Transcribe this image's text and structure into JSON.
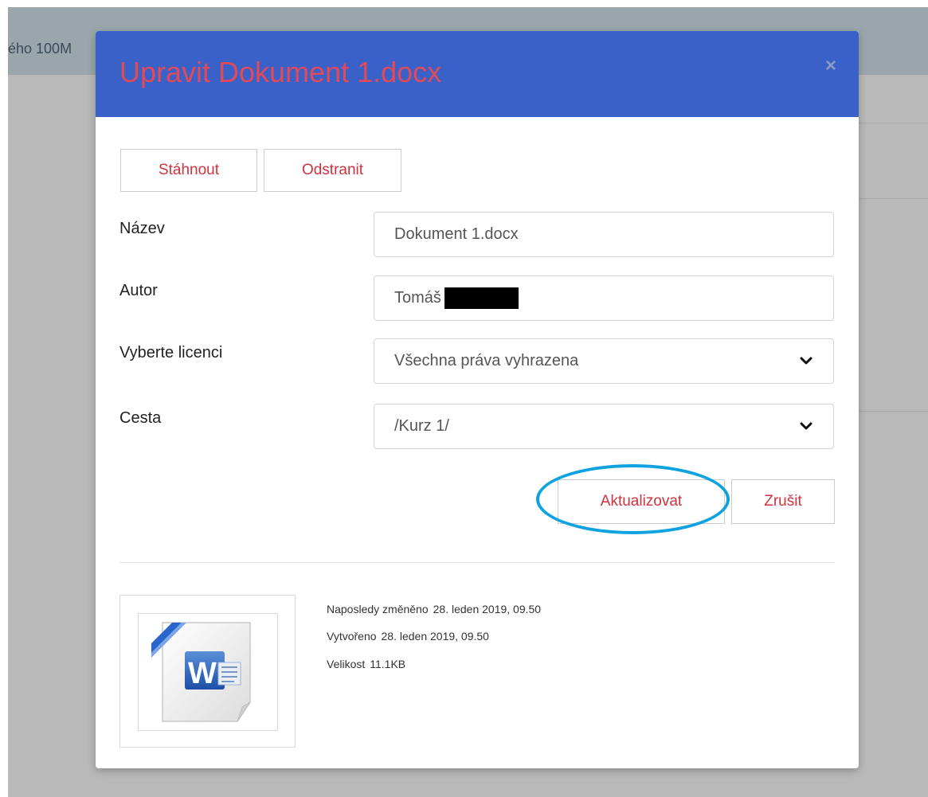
{
  "background": {
    "header_text": "ého 100M"
  },
  "modal": {
    "title": "Upravit Dokument 1.docx",
    "close_icon": "close-icon",
    "close_glyph": "×"
  },
  "toolbar": {
    "download_label": "Stáhnout",
    "delete_label": "Odstranit"
  },
  "form": {
    "name_label": "Název",
    "name_value": "Dokument 1.docx",
    "author_label": "Autor",
    "author_value": "Tomáš",
    "license_label": "Vyberte licenci",
    "license_value": "Všechna práva vyhrazena",
    "path_label": "Cesta",
    "path_value": "/Kurz 1/"
  },
  "actions": {
    "update_label": "Aktualizovat",
    "cancel_label": "Zrušit"
  },
  "file_info": {
    "modified_label": "Naposledy změněno",
    "modified_value": "28. leden 2019, 09.50",
    "created_label": "Vytvořeno",
    "created_value": "28. leden 2019, 09.50",
    "size_label": "Velikost",
    "size_value": "11.1KB",
    "thumbnail_icon": "word-document-icon"
  },
  "colors": {
    "header_bg": "#3a61c8",
    "title": "#e04a5a",
    "button_text": "#d0323e",
    "highlight": "#0ea3e0"
  }
}
